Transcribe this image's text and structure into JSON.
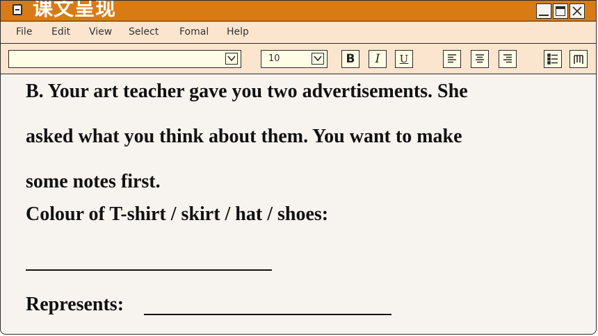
{
  "window": {
    "title": "课文呈现",
    "controls": [
      "minimize-icon",
      "maximize-icon",
      "close-icon"
    ]
  },
  "menu": {
    "items": [
      "File",
      "Edit",
      "View",
      "Select",
      "Fomal",
      "Help"
    ]
  },
  "toolbar": {
    "font_name_value": "",
    "font_size_value": "10",
    "bold_label": "B",
    "italic_label": "I",
    "underline_label": "U",
    "icons": [
      "align-left-icon",
      "align-center-icon",
      "align-right-icon",
      "bullet-list-icon",
      "columns-icon"
    ]
  },
  "document": {
    "lines": [
      "B. Your art teacher gave you two advertisements. She",
      "asked what you think about them. You want to make",
      "some notes first.",
      "Colour of T-shirt / skirt / hat / shoes:"
    ],
    "represents_label": "Represents:"
  },
  "colors": {
    "titlebar": "#d97b14",
    "menubar": "#fbe5cf",
    "document_bg": "#f7f3ee",
    "input_bg": "#fffde6"
  }
}
